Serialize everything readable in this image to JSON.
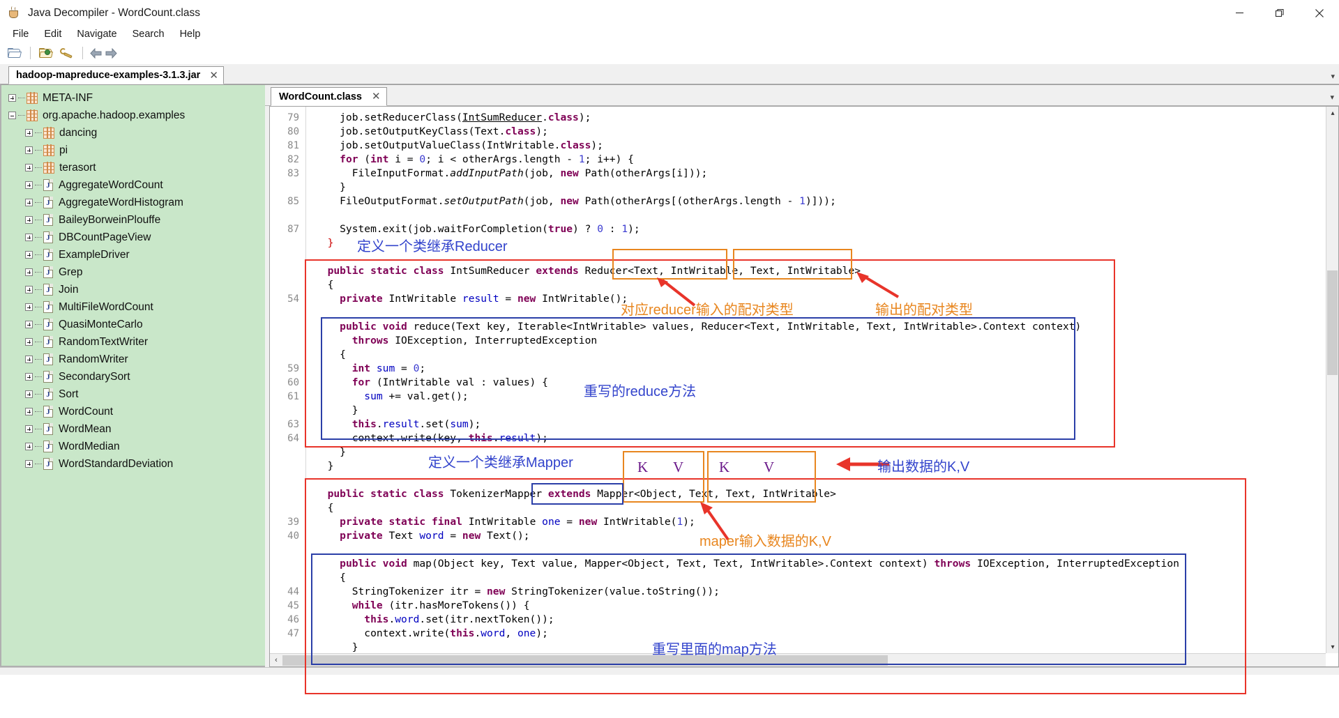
{
  "window": {
    "title": "Java Decompiler - WordCount.class",
    "icon": "java-cup-icon",
    "minimize_label": "—",
    "maximize_label": "❐",
    "close_label": "✕"
  },
  "menubar": {
    "items": [
      {
        "label": "File"
      },
      {
        "label": "Edit"
      },
      {
        "label": "Navigate"
      },
      {
        "label": "Search"
      },
      {
        "label": "Help"
      }
    ]
  },
  "toolbar": {
    "buttons": [
      {
        "name": "open-folder-icon",
        "tooltip": "Open File"
      },
      {
        "name": "open-recent-icon",
        "tooltip": "Open Recent"
      },
      {
        "name": "preferences-wrench-icon",
        "tooltip": "Preferences"
      },
      {
        "name": "back-arrow-icon",
        "tooltip": "Back"
      },
      {
        "name": "forward-arrow-icon",
        "tooltip": "Forward"
      }
    ]
  },
  "jar_tab": {
    "label": "hadoop-mapreduce-examples-3.1.3.jar",
    "close": "✕",
    "scroll_marker": "▾"
  },
  "tree": {
    "nodes": [
      {
        "label": "META-INF",
        "icon": "package-icon",
        "indent": 0,
        "state": "collapsed"
      },
      {
        "label": "org.apache.hadoop.examples",
        "icon": "package-icon",
        "indent": 0,
        "state": "expanded"
      },
      {
        "label": "dancing",
        "icon": "package-icon",
        "indent": 1,
        "state": "collapsed"
      },
      {
        "label": "pi",
        "icon": "package-icon",
        "indent": 1,
        "state": "collapsed"
      },
      {
        "label": "terasort",
        "icon": "package-icon",
        "indent": 1,
        "state": "collapsed"
      },
      {
        "label": "AggregateWordCount",
        "icon": "java-class-icon",
        "indent": 1,
        "state": "collapsed"
      },
      {
        "label": "AggregateWordHistogram",
        "icon": "java-class-icon",
        "indent": 1,
        "state": "collapsed"
      },
      {
        "label": "BaileyBorweinPlouffe",
        "icon": "java-class-icon",
        "indent": 1,
        "state": "collapsed"
      },
      {
        "label": "DBCountPageView",
        "icon": "java-class-icon",
        "indent": 1,
        "state": "collapsed"
      },
      {
        "label": "ExampleDriver",
        "icon": "java-class-icon",
        "indent": 1,
        "state": "collapsed"
      },
      {
        "label": "Grep",
        "icon": "java-class-icon",
        "indent": 1,
        "state": "collapsed"
      },
      {
        "label": "Join",
        "icon": "java-class-icon",
        "indent": 1,
        "state": "collapsed"
      },
      {
        "label": "MultiFileWordCount",
        "icon": "java-class-icon",
        "indent": 1,
        "state": "collapsed"
      },
      {
        "label": "QuasiMonteCarlo",
        "icon": "java-class-icon",
        "indent": 1,
        "state": "collapsed"
      },
      {
        "label": "RandomTextWriter",
        "icon": "java-class-icon",
        "indent": 1,
        "state": "collapsed"
      },
      {
        "label": "RandomWriter",
        "icon": "java-class-icon",
        "indent": 1,
        "state": "collapsed"
      },
      {
        "label": "SecondarySort",
        "icon": "java-class-icon",
        "indent": 1,
        "state": "collapsed"
      },
      {
        "label": "Sort",
        "icon": "java-class-icon",
        "indent": 1,
        "state": "collapsed"
      },
      {
        "label": "WordCount",
        "icon": "java-class-icon",
        "indent": 1,
        "state": "collapsed"
      },
      {
        "label": "WordMean",
        "icon": "java-class-icon",
        "indent": 1,
        "state": "collapsed"
      },
      {
        "label": "WordMedian",
        "icon": "java-class-icon",
        "indent": 1,
        "state": "collapsed"
      },
      {
        "label": "WordStandardDeviation",
        "icon": "java-class-icon",
        "indent": 1,
        "state": "collapsed"
      }
    ]
  },
  "class_tab": {
    "label": "WordCount.class",
    "close": "✕",
    "scroll_marker": "▾"
  },
  "code": {
    "lines": [
      {
        "num": "79",
        "text": "    job.setReducerClass(IntSumReducer.class);"
      },
      {
        "num": "80",
        "text": "    job.setOutputKeyClass(Text.class);"
      },
      {
        "num": "81",
        "text": "    job.setOutputValueClass(IntWritable.class);"
      },
      {
        "num": "82",
        "text": "    for (int i = 0; i < otherArgs.length - 1; i++) {"
      },
      {
        "num": "83",
        "text": "      FileInputFormat.addInputPath(job, new Path(otherArgs[i]));"
      },
      {
        "num": "",
        "text": "    }"
      },
      {
        "num": "85",
        "text": "    FileOutputFormat.setOutputPath(job, new Path(otherArgs[(otherArgs.length - 1)]));"
      },
      {
        "num": "",
        "text": ""
      },
      {
        "num": "87",
        "text": "    System.exit(job.waitForCompletion(true) ? 0 : 1);"
      },
      {
        "num": "",
        "text": "  }"
      },
      {
        "num": "",
        "text": ""
      },
      {
        "num": "",
        "text": "  public static class IntSumReducer extends Reducer<Text, IntWritable, Text, IntWritable>"
      },
      {
        "num": "",
        "text": "  {"
      },
      {
        "num": "54",
        "text": "    private IntWritable result = new IntWritable();"
      },
      {
        "num": "",
        "text": ""
      },
      {
        "num": "",
        "text": "    public void reduce(Text key, Iterable<IntWritable> values, Reducer<Text, IntWritable, Text, IntWritable>.Context context)"
      },
      {
        "num": "",
        "text": "      throws IOException, InterruptedException"
      },
      {
        "num": "",
        "text": "    {"
      },
      {
        "num": "59",
        "text": "      int sum = 0;"
      },
      {
        "num": "60",
        "text": "      for (IntWritable val : values) {"
      },
      {
        "num": "61",
        "text": "        sum += val.get();"
      },
      {
        "num": "",
        "text": "      }"
      },
      {
        "num": "63",
        "text": "      this.result.set(sum);"
      },
      {
        "num": "64",
        "text": "      context.write(key, this.result);"
      },
      {
        "num": "",
        "text": "    }"
      },
      {
        "num": "",
        "text": "  }"
      },
      {
        "num": "",
        "text": ""
      },
      {
        "num": "",
        "text": "  public static class TokenizerMapper extends Mapper<Object, Text, Text, IntWritable>"
      },
      {
        "num": "",
        "text": "  {"
      },
      {
        "num": "39",
        "text": "    private static final IntWritable one = new IntWritable(1);"
      },
      {
        "num": "40",
        "text": "    private Text word = new Text();"
      },
      {
        "num": "",
        "text": ""
      },
      {
        "num": "",
        "text": "    public void map(Object key, Text value, Mapper<Object, Text, Text, IntWritable>.Context context) throws IOException, InterruptedException"
      },
      {
        "num": "",
        "text": "    {"
      },
      {
        "num": "44",
        "text": "      StringTokenizer itr = new StringTokenizer(value.toString());"
      },
      {
        "num": "45",
        "text": "      while (itr.hasMoreTokens()) {"
      },
      {
        "num": "46",
        "text": "        this.word.set(itr.nextToken());"
      },
      {
        "num": "47",
        "text": "        context.write(this.word, one);"
      },
      {
        "num": "",
        "text": "      }"
      },
      {
        "num": "",
        "text": "    }"
      },
      {
        "num": "",
        "text": "  }"
      },
      {
        "num": "",
        "text": "}"
      }
    ]
  },
  "annotations": {
    "define_reducer": "定义一个类继承Reducer",
    "reducer_input_pair": "对应reducer输入的配对类型",
    "reducer_output_pair": "输出的配对类型",
    "override_reduce": "重写的reduce方法",
    "define_mapper": "定义一个类继承Mapper",
    "output_kv": "输出数据的K,V",
    "mapper_input_kv": "maper输入数据的K,V",
    "override_map": "重写里面的map方法",
    "k_label": "K",
    "v_label": "V",
    "colors": {
      "red_box": "#e8342a",
      "orange_box": "#e8861f",
      "blue_box": "#2b3fa8",
      "blue_text": "#3344cc",
      "orange_text": "#e8861f",
      "kv_text": "#6b1a8a",
      "arrow_red": "#e8342a"
    }
  },
  "scrollbars": {
    "vertical_up": "▴",
    "vertical_down": "▾",
    "horizontal_left": "‹",
    "horizontal_right": "›"
  }
}
